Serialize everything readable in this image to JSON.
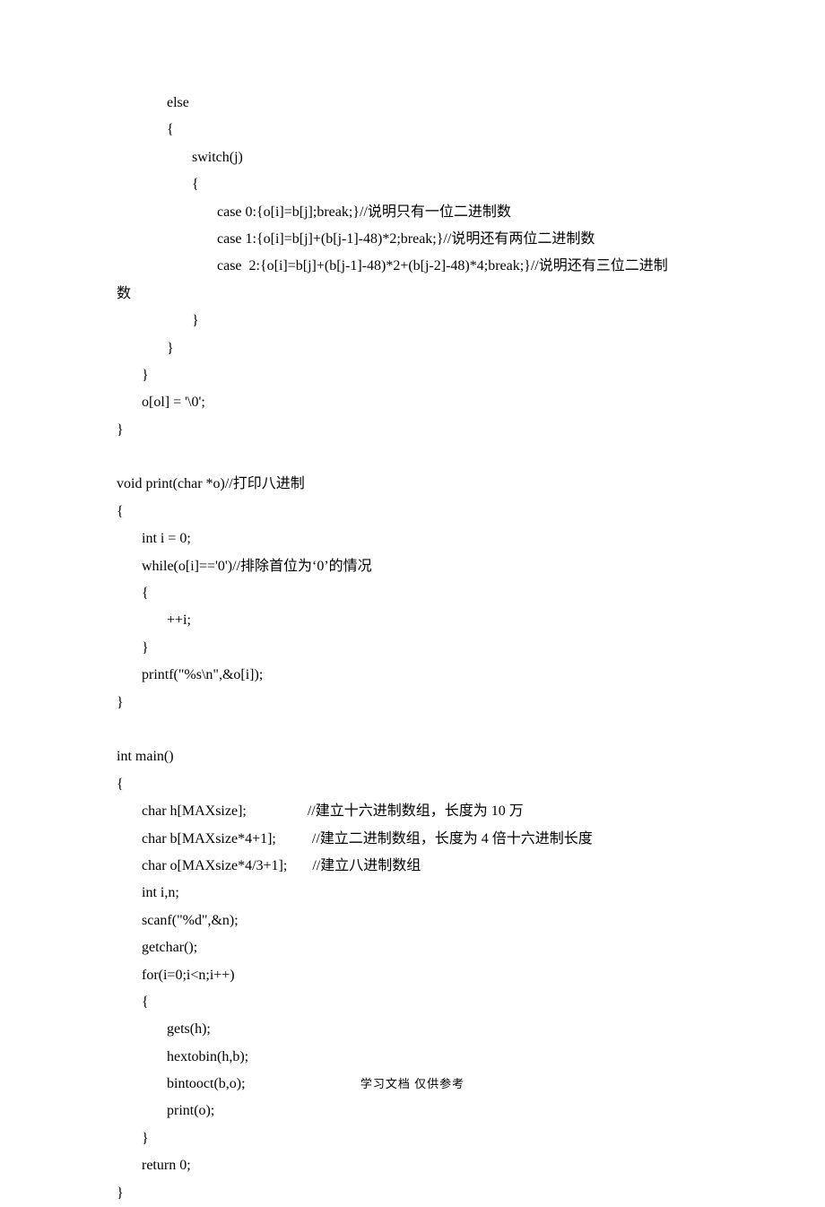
{
  "lines": [
    "              else",
    "              {",
    "                     switch(j)",
    "                     {",
    "                            case 0:{o[i]=b[j];break;}//说明只有一位二进制数",
    "                            case 1:{o[i]=b[j]+(b[j-1]-48)*2;break;}//说明还有两位二进制数",
    "                            case  2:{o[i]=b[j]+(b[j-1]-48)*2+(b[j-2]-48)*4;break;}//说明还有三位二进制",
    "数",
    "                     }",
    "              }",
    "       }",
    "       o[ol] = '\\0';",
    "}",
    "",
    "void print(char *o)//打印八进制",
    "{",
    "       int i = 0;",
    "       while(o[i]=='0')//排除首位为‘0’的情况",
    "       {",
    "              ++i;",
    "       }",
    "       printf(\"%s\\n\",&o[i]);",
    "}",
    "",
    "int main()",
    "{",
    "       char h[MAXsize];                 //建立十六进制数组，长度为 10 万",
    "       char b[MAXsize*4+1];          //建立二进制数组，长度为 4 倍十六进制长度",
    "       char o[MAXsize*4/3+1];       //建立八进制数组",
    "       int i,n;",
    "       scanf(\"%d\",&n);",
    "       getchar();",
    "       for(i=0;i<n;i++)",
    "       {",
    "              gets(h);",
    "              hextobin(h,b);",
    "              bintooct(b,o);",
    "              print(o);",
    "       }",
    "       return 0;",
    "}"
  ],
  "footer": "学习文档 仅供参考"
}
